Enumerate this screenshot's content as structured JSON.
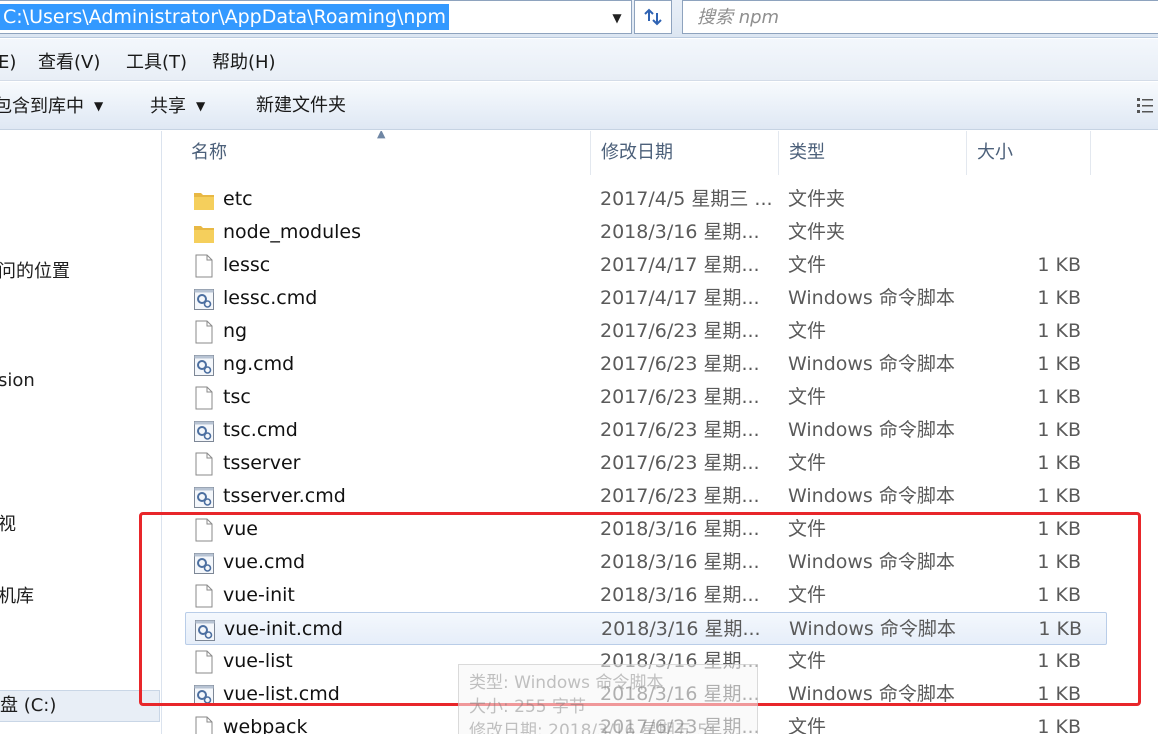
{
  "address_bar": {
    "path": "C:\\Users\\Administrator\\AppData\\Roaming\\npm",
    "search_placeholder": "搜索 npm"
  },
  "menu": [
    {
      "label": "E)"
    },
    {
      "label": "查看(V)"
    },
    {
      "label": "工具(T)"
    },
    {
      "label": "帮助(H)"
    }
  ],
  "commands": {
    "include_library": "包含到库中",
    "share": "共享",
    "new_folder": "新建文件夹"
  },
  "nav": [
    {
      "label": "问的位置"
    },
    {
      "label": "sion"
    },
    {
      "label": "视"
    },
    {
      "label": "机库"
    },
    {
      "label": "盘 (C:)"
    }
  ],
  "columns": {
    "name": "名称",
    "date": "修改日期",
    "type": "类型",
    "size": "大小"
  },
  "files": [
    {
      "name": "etc",
      "date": "2017/4/5 星期三 ...",
      "type": "文件夹",
      "size": "",
      "icon": "folder-icon"
    },
    {
      "name": "node_modules",
      "date": "2018/3/16 星期...",
      "type": "文件夹",
      "size": "",
      "icon": "folder-icon"
    },
    {
      "name": "lessc",
      "date": "2017/4/17 星期...",
      "type": "文件",
      "size": "1 KB",
      "icon": "file-icon"
    },
    {
      "name": "lessc.cmd",
      "date": "2017/4/17 星期...",
      "type": "Windows 命令脚本",
      "size": "1 KB",
      "icon": "cmd-file-icon"
    },
    {
      "name": "ng",
      "date": "2017/6/23 星期...",
      "type": "文件",
      "size": "1 KB",
      "icon": "file-icon"
    },
    {
      "name": "ng.cmd",
      "date": "2017/6/23 星期...",
      "type": "Windows 命令脚本",
      "size": "1 KB",
      "icon": "cmd-file-icon"
    },
    {
      "name": "tsc",
      "date": "2017/6/23 星期...",
      "type": "文件",
      "size": "1 KB",
      "icon": "file-icon"
    },
    {
      "name": "tsc.cmd",
      "date": "2017/6/23 星期...",
      "type": "Windows 命令脚本",
      "size": "1 KB",
      "icon": "cmd-file-icon"
    },
    {
      "name": "tsserver",
      "date": "2017/6/23 星期...",
      "type": "文件",
      "size": "1 KB",
      "icon": "file-icon"
    },
    {
      "name": "tsserver.cmd",
      "date": "2017/6/23 星期...",
      "type": "Windows 命令脚本",
      "size": "1 KB",
      "icon": "cmd-file-icon"
    },
    {
      "name": "vue",
      "date": "2018/3/16 星期...",
      "type": "文件",
      "size": "1 KB",
      "icon": "file-icon"
    },
    {
      "name": "vue.cmd",
      "date": "2018/3/16 星期...",
      "type": "Windows 命令脚本",
      "size": "1 KB",
      "icon": "cmd-file-icon"
    },
    {
      "name": "vue-init",
      "date": "2018/3/16 星期...",
      "type": "文件",
      "size": "1 KB",
      "icon": "file-icon"
    },
    {
      "name": "vue-init.cmd",
      "date": "2018/3/16 星期...",
      "type": "Windows 命令脚本",
      "size": "1 KB",
      "icon": "cmd-file-icon"
    },
    {
      "name": "vue-list",
      "date": "2018/3/16 星期...",
      "type": "文件",
      "size": "1 KB",
      "icon": "file-icon"
    },
    {
      "name": "vue-list.cmd",
      "date": "2018/3/16 星期...",
      "type": "Windows 命令脚本",
      "size": "1 KB",
      "icon": "cmd-file-icon"
    },
    {
      "name": "webpack",
      "date": "2017/6/23 星期...",
      "type": "文件",
      "size": "1 KB",
      "icon": "file-icon"
    }
  ],
  "hovered_file": "vue-init.cmd",
  "tooltip": {
    "line1": "类型: Windows 命令脚本",
    "line2": "大小: 255 字节",
    "line3": "修改日期: 2018/3/16 星期五 5:..."
  },
  "colors": {
    "selection": "#3399ff",
    "highlight_box": "#e8262a"
  }
}
